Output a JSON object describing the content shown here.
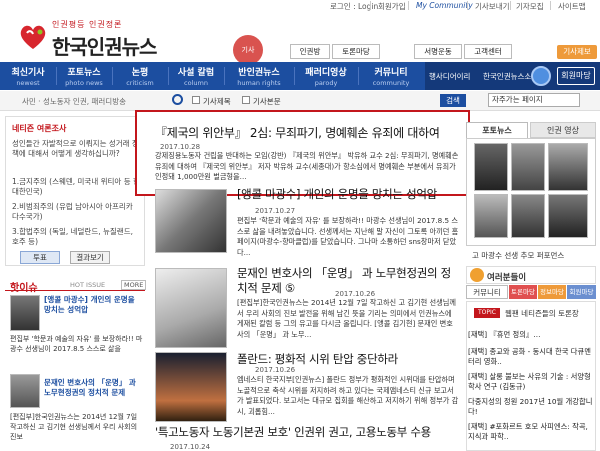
{
  "topbar": {
    "login": "로그인 : Login",
    "join": "회원가입",
    "community": "My Community",
    "reporter_ad": "기사보내기",
    "reporter_apply": "기자모집",
    "sitemap": "사이트맵"
  },
  "logo": {
    "subtitle": "인권평등 인권정론",
    "title": "한국인권뉴스"
  },
  "ad_badge": "기사",
  "service_tabs": [
    "인권방",
    "토론마당",
    "서명운동",
    "고객센터"
  ],
  "sub_tabs": [
    "인권신문"
  ],
  "gisa_button": "기사제보",
  "nav": [
    {
      "ko": "최신기사",
      "en": "newest"
    },
    {
      "ko": "포토뉴스",
      "en": "photo news"
    },
    {
      "ko": "논평",
      "en": "criticism"
    },
    {
      "ko": "사설 칼럼",
      "en": "column"
    },
    {
      "ko": "반인권뉴스",
      "en": "human rights"
    },
    {
      "ko": "패러디영상",
      "en": "parody"
    },
    {
      "ko": "커뮤니티",
      "en": "community"
    }
  ],
  "nav_right": {
    "item1": "행사디어이리",
    "item2": "한국인권뉴스소개",
    "member": "회원마당"
  },
  "search": {
    "breadcrumb": "사민 · 성노동자 인권, 패러디방송",
    "opt1": "기사제목",
    "opt2": "기사본문",
    "button": "검색",
    "select": "자주가는 페이지"
  },
  "left": {
    "poll_title": "네티즌 여론조사",
    "poll_question": "성인들간 자발적으로 이뤄지는 성거래 정책에 대해서 어떻게 생각하십니까?",
    "poll_options": [
      "1.금지주의 (스웨덴, 미국내 위티아 등 현 대한민국)",
      "2.비범죄주의 (유럽 남아시아 아프리카 다수국가)",
      "3.합법주의 (독일, 네덜란드, 뉴질랜드, 호주 등)"
    ],
    "vote_button": "투표",
    "result_button": "결과보기",
    "hot_title": "핫이슈",
    "hot_label": "HOT ISSUE",
    "more": "MORE",
    "hot_items": [
      {
        "title": "[앵콜 마광수] 개인의 운명을 망치는 성억압",
        "body": "편집부 '학문과 예술의 자유' 를 보장하라!! 마광수 선생님이 2017.8.5 스스로 삶을"
      },
      {
        "title": "문재인 변호사의 「운명」 과 노무현정권의 정치적 문제",
        "body": "[편집부]한국인권뉴스는 2014년 12월 7일 작고하신 고 김기현 선생님께서 우리 사회의 진보"
      }
    ]
  },
  "articles": [
    {
      "title": "『제국의 위안부』 2심: 무죄파기, 명예훼손 유죄에 대하여",
      "date": "2017.10.28",
      "body": "강제징용노동자 건립을 반대하는 모임(강반) 『제국의 위안부』 박유하 교수 2심: 무죄파기, 명예훼손 유죄에 대하여 『제국의 위안부』 저자 박유하 교수(세종대)가 항소심에서 명예훼손 부분에서 유죄가 인정돼 1,000만원 벌금형을..."
    },
    {
      "title": "[앵콜 마광수] 개인의 운명을 망치는 성억압",
      "date": "2017.10.27",
      "body": "편집부 '학문과 예술의 자유' 를 보장하라!! 마광수 선생님이 2017.8.5 스스로 삶을 내려놓았습니다. 선생께서는 지난해 말 자신이 그토록 아끼던 홈페이지(마광수-향마클럽)를 닫았습니다. 그나마 소통하던 sns창마저 닫았다..."
    },
    {
      "title": "문재인 변호사의 「운명」 과 노무현정권의 정치적 문제 ⑤",
      "date": "2017.10.26",
      "body": "[편집부]한국인권뉴스는 2014년 12월 7일 작고하신 고 김기현 선생님께서 우리 사회의 진보 발전을 위해 남긴 뜻을 기리는 의미에서 인권뉴스에 게재된 칼럼 등 그의 유고를 다시금 올립니다. [앵콜 김기현] 문재인 변호사의 「운명」 과 노무..."
    },
    {
      "title": "폴란드: 평화적 시위 탄압 중단하라",
      "date": "2017.10.26",
      "body": "엠네스티 한국지부[인권뉴스] 폴란드 정부가 평화적인 시위대를 탄압하며 노골적으로 축삭 시위를 저지하려 하고 있다는 국제앰네스티 신규 보고서가 발표되었다. 보고서는 대규모 집회를 해산하고 저지하기 위해 정부가 감시, 괴롭힘..."
    },
    {
      "title": "'특고노동자 노동기본권 보호' 인권위 권고, 고용노동부 수용",
      "date": "2017.10.24",
      "body": ""
    }
  ],
  "right": {
    "tabs": [
      "포토뉴스",
      "인권 영상"
    ],
    "photo_caption": "고 마광수 선생 추모 퍼포먼스",
    "community_header": "여러분들이 만드는 한국인권뉴스!",
    "community_header_title": "여러분들이",
    "community_tabs": [
      "커뮤니티",
      "토론마당",
      "정보마당",
      "회원마당"
    ],
    "forum_title": "웹팬 네티즌들의 토론장",
    "forum_items": [
      "[재택] 『휴먼 정의』…",
      "[재택] 종교와 공화 - 동시대 한국 다큐멘터리 영화..",
      "[재택] 살롱 불보는 사유의 기술 : 서양형학사 연구 (김동규)",
      "다중지성의 정원 2017년 10월 개강합니다!",
      "[재택] #포화르트 호모 사피엔스: 작곡, 지식과 파학.."
    ]
  },
  "colors": {
    "nav_blue": "#1c4ea0",
    "brand_red": "#c3161c",
    "orange": "#ee9a3a"
  }
}
